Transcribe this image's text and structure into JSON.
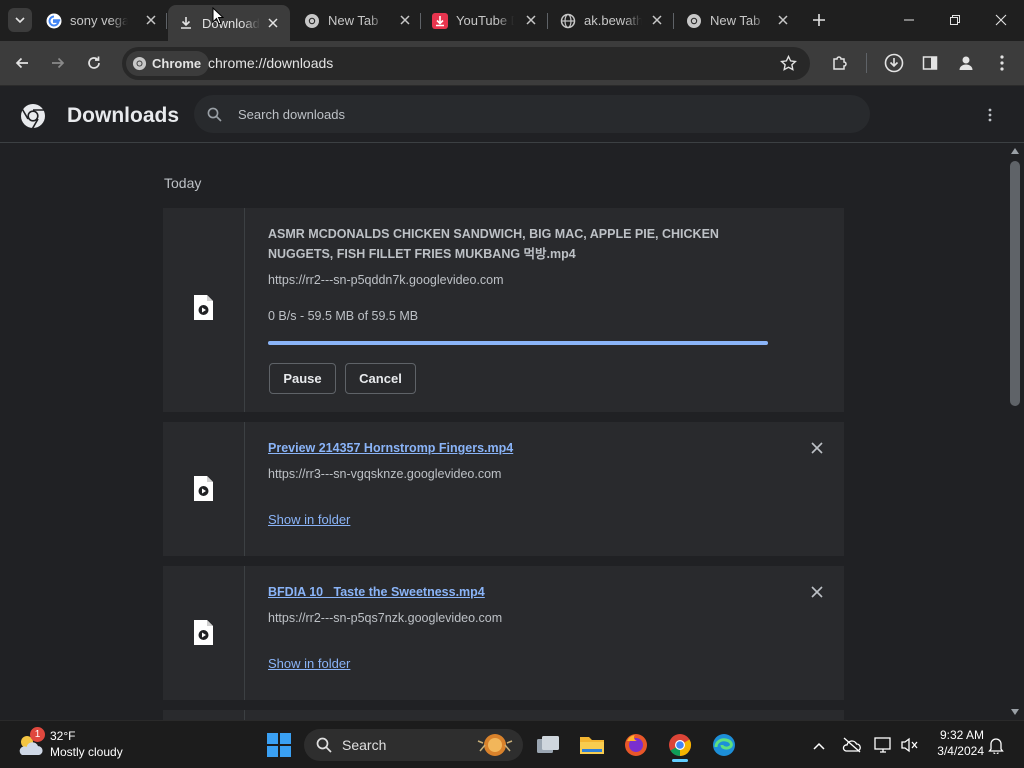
{
  "tabs": [
    {
      "title": "sony vegas",
      "favicon": "google-icon"
    },
    {
      "title": "Downloads",
      "favicon": "download-icon",
      "active": true
    },
    {
      "title": "New Tab",
      "favicon": "chrome-icon"
    },
    {
      "title": "YouTube Downloader",
      "favicon": "youtube-downloader-icon"
    },
    {
      "title": "ak.bewathe",
      "favicon": "globe-icon"
    },
    {
      "title": "New Tab",
      "favicon": "chrome-icon"
    }
  ],
  "toolbar": {
    "chip_label": "Chrome",
    "url": "chrome://downloads"
  },
  "downloads_page": {
    "title": "Downloads",
    "search_placeholder": "Search downloads",
    "section_label": "Today",
    "items": [
      {
        "filename": "ASMR MCDONALDS CHICKEN SANDWICH, BIG MAC, APPLE PIE, CHICKEN NUGGETS, FISH FILLET FRIES MUKBANG 먹방.mp4",
        "source": "https://rr2---sn-p5qddn7k.googlevideo.com",
        "status": "0 B/s - 59.5 MB of 59.5 MB",
        "progress_percent": 100,
        "pause_label": "Pause",
        "cancel_label": "Cancel",
        "in_progress": true
      },
      {
        "filename": "Preview 214357 Hornstromp Fingers.mp4",
        "source": "https://rr3---sn-vgqsknze.googlevideo.com",
        "show_in_folder_label": "Show in folder"
      },
      {
        "filename": "BFDIA 10_ Taste the Sweetness.mp4",
        "source": "https://rr2---sn-p5qs7nzk.googlevideo.com",
        "show_in_folder_label": "Show in folder"
      }
    ]
  },
  "taskbar": {
    "weather_temp": "32°F",
    "weather_desc": "Mostly cloudy",
    "weather_badge": "1",
    "search_label": "Search",
    "time": "9:32 AM",
    "date": "3/4/2024"
  },
  "colors": {
    "accent": "#8ab4f8",
    "background": "#202124",
    "card": "#292a2d"
  }
}
